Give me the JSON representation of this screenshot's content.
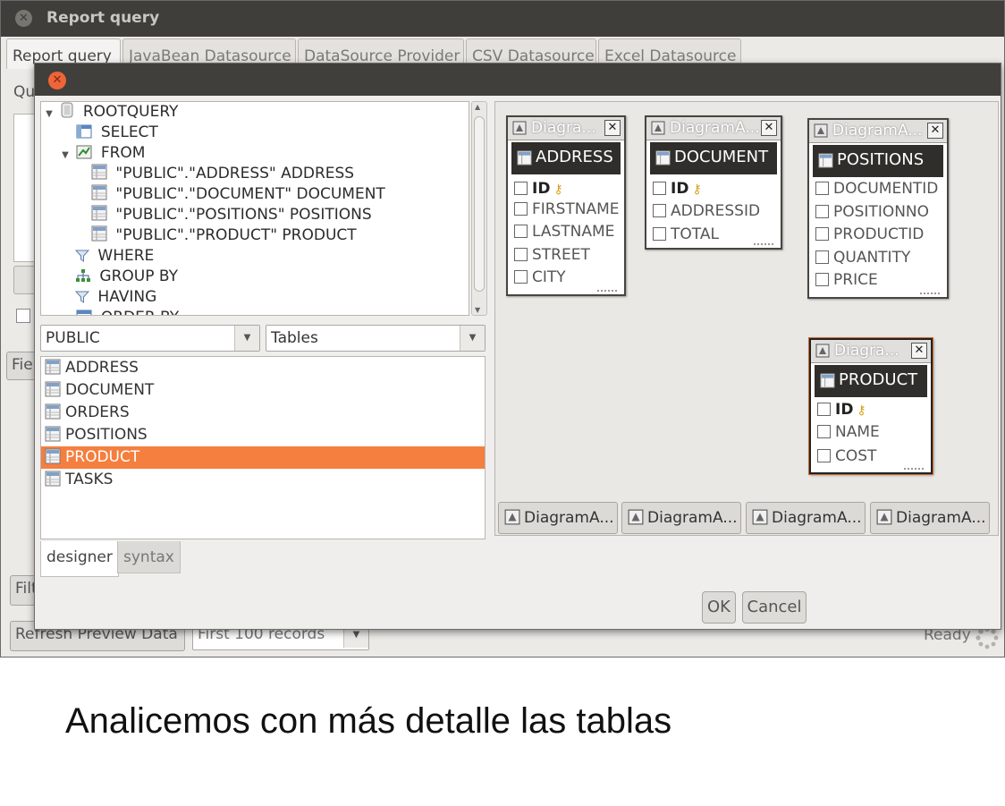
{
  "outer_window": {
    "title": "Report query",
    "tabs": [
      "Report query",
      "JavaBean Datasource",
      "DataSource Provider",
      "CSV Datasource",
      "Excel Datasource"
    ],
    "side_labels": {
      "query": "Qu",
      "fields": "Fiel",
      "filter": "Filt"
    },
    "refresh_button": "Refresh Preview Data",
    "records_combo": "First 100 records",
    "status": "Ready"
  },
  "dialog": {
    "tree": [
      {
        "label": "ROOTQUERY",
        "icon": "database-icon",
        "expanded": true
      },
      {
        "label": "SELECT",
        "icon": "select-icon"
      },
      {
        "label": "FROM",
        "icon": "from-icon",
        "expanded": true
      },
      {
        "label": "\"PUBLIC\".\"ADDRESS\" ADDRESS",
        "icon": "table-icon"
      },
      {
        "label": "\"PUBLIC\".\"DOCUMENT\" DOCUMENT",
        "icon": "table-icon"
      },
      {
        "label": "\"PUBLIC\".\"POSITIONS\" POSITIONS",
        "icon": "table-icon"
      },
      {
        "label": "\"PUBLIC\".\"PRODUCT\" PRODUCT",
        "icon": "table-icon"
      },
      {
        "label": "WHERE",
        "icon": "filter-icon"
      },
      {
        "label": "GROUP BY",
        "icon": "group-icon"
      },
      {
        "label": "HAVING",
        "icon": "filter-icon"
      },
      {
        "label": "ORDER BY",
        "icon": "order-icon"
      }
    ],
    "schema_combo": "PUBLIC",
    "type_combo": "Tables",
    "tables": [
      "ADDRESS",
      "DOCUMENT",
      "ORDERS",
      "POSITIONS",
      "PRODUCT",
      "TASKS"
    ],
    "selected_table": "PRODUCT",
    "bottom_tabs": [
      "designer",
      "syntax"
    ],
    "diagram_tables": [
      {
        "header": "Diagra...",
        "name": "ADDRESS",
        "fields": [
          {
            "name": "ID",
            "key": true
          },
          {
            "name": "FIRSTNAME"
          },
          {
            "name": "LASTNAME"
          },
          {
            "name": "STREET"
          },
          {
            "name": "CITY"
          }
        ]
      },
      {
        "header": "DiagramA...",
        "name": "DOCUMENT",
        "fields": [
          {
            "name": "ID",
            "key": true
          },
          {
            "name": "ADDRESSID"
          },
          {
            "name": "TOTAL"
          }
        ]
      },
      {
        "header": "DiagramA...",
        "name": "POSITIONS",
        "fields": [
          {
            "name": "DOCUMENTID"
          },
          {
            "name": "POSITIONNO"
          },
          {
            "name": "PRODUCTID"
          },
          {
            "name": "QUANTITY"
          },
          {
            "name": "PRICE"
          }
        ]
      },
      {
        "header": "Diagra...",
        "name": "PRODUCT",
        "fields": [
          {
            "name": "ID",
            "key": true
          },
          {
            "name": "NAME"
          },
          {
            "name": "COST"
          }
        ]
      }
    ],
    "diagram_buttons": [
      "DiagramA...",
      "DiagramA...",
      "DiagramA...",
      "DiagramA..."
    ],
    "ok_button": "OK",
    "cancel_button": "Cancel"
  },
  "caption": "Analicemos con más detalle las tablas",
  "colors": {
    "selection": "#f47f3f",
    "title_bar": "#3f3e3a",
    "close_button": "#f0643a"
  }
}
